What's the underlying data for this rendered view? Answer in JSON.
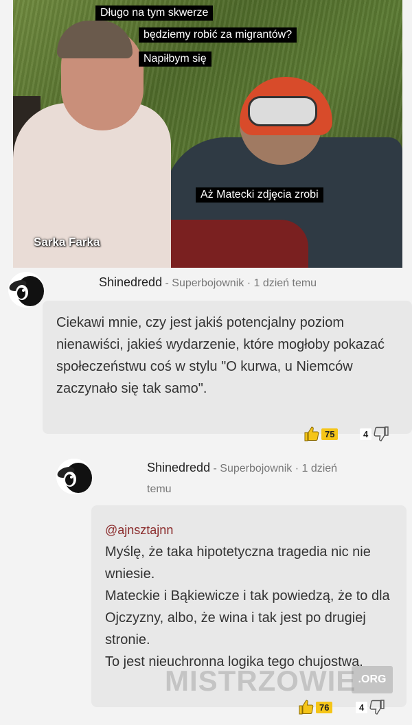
{
  "meme": {
    "captions": [
      "Długo na tym skwerze",
      "będziemy robić za migrantów?",
      "Napiłbym się",
      "Aż Matecki zdjęcia zrobi"
    ],
    "credit": "Sarka Farka"
  },
  "comments": [
    {
      "author": "Shinedredd",
      "meta": " - Superbojownik · 1 dzień temu",
      "body": "Ciekawi mnie, czy jest jakiś potencjalny poziom nienawiści, jakieś wydarzenie, które mogłoby pokazać społeczeństwu coś w stylu \"O kurwa, u Niemców zaczynało się tak samo\".",
      "upvotes": "75",
      "downvotes": "4"
    },
    {
      "author": "Shinedredd",
      "meta_line1": " - Superbojownik · 1 dzień",
      "meta_line2": "temu",
      "mention": "@ajnsztajnn",
      "body_lines": [
        "Myślę, że taka hipotetyczna tragedia nic nie wniesie.",
        "Mateckie i Bąkiewicze i tak powiedzą, że to dla Ojczyzny, albo, że wina i tak jest po drugiej stronie.",
        "To jest nieuchronna logika tego chujostwa."
      ],
      "upvotes": "76",
      "downvotes": "4"
    }
  ],
  "watermark": {
    "main": "MISTRZOWIE",
    "suffix": ".ORG"
  },
  "icons": {
    "thumb_up": "thumbs-up-icon",
    "thumb_down": "thumbs-down-icon",
    "avatar": "black-sheep-avatar"
  },
  "colors": {
    "upvote_badge": "#f5c518",
    "mention": "#8a2a2a",
    "bubble_bg": "#e8e8e8"
  }
}
